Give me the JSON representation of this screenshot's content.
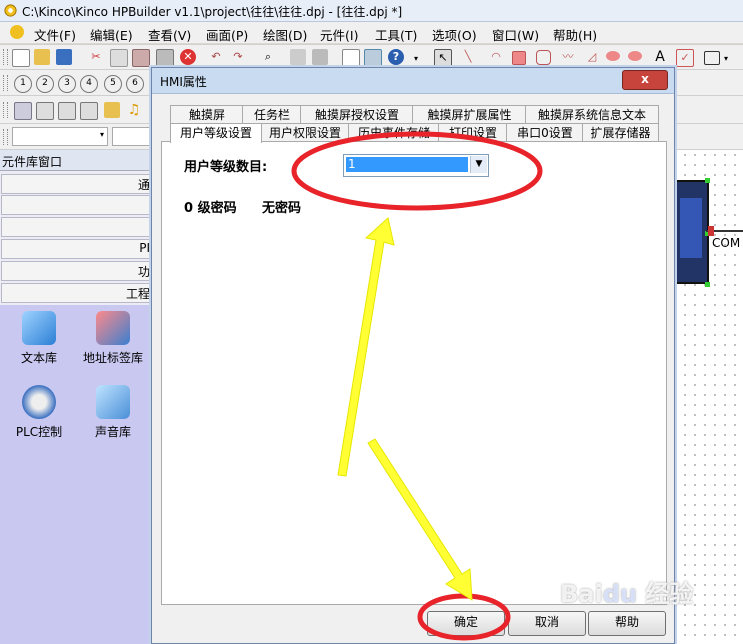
{
  "window": {
    "title": "C:\\Kinco\\Kinco HPBuilder v1.1\\project\\往往\\往往.dpj - [往往.dpj *]"
  },
  "menubar": {
    "items": [
      "文件(F)",
      "编辑(E)",
      "查看(V)",
      "画面(P)",
      "绘图(D)",
      "元件(I)",
      "工具(T)",
      "选项(O)",
      "窗口(W)",
      "帮助(H)"
    ]
  },
  "toolbar": {
    "row2_numbers": [
      "1",
      "2",
      "3",
      "4",
      "5",
      "6"
    ]
  },
  "left_panel": {
    "title": "元件库窗口",
    "categories": [
      "通",
      "",
      "",
      "PI",
      "功",
      "工程"
    ],
    "libraries": [
      {
        "label": "文本库",
        "icon": "text-library-icon"
      },
      {
        "label": "地址标签库",
        "icon": "address-tag-library-icon"
      },
      {
        "label": "PLC控制",
        "icon": "plc-control-icon"
      },
      {
        "label": "声音库",
        "icon": "sound-library-icon"
      }
    ]
  },
  "canvas": {
    "com_label": "COM"
  },
  "dialog": {
    "title": "HMI属性",
    "close_label": "x",
    "tabs_row1": [
      "触摸屏",
      "任务栏",
      "触摸屏授权设置",
      "触摸屏扩展属性",
      "触摸屏系统信息文本"
    ],
    "tabs_row2": [
      "用户等级设置",
      "用户权限设置",
      "历史事件存储",
      "打印设置",
      "串口0设置",
      "扩展存储器"
    ],
    "active_tab": "用户等级设置",
    "user_level_label": "用户等级数目:",
    "user_level_value": "1",
    "password_level": "0 级密码",
    "password_value": "无密码",
    "buttons": {
      "ok": "确定",
      "cancel": "取消",
      "help": "帮助"
    }
  },
  "colors": {
    "accent_select": "#3399ff",
    "annotation_red": "#e8232a",
    "annotation_yellow": "#ffff33",
    "library_panel": "#c8c8f0"
  }
}
